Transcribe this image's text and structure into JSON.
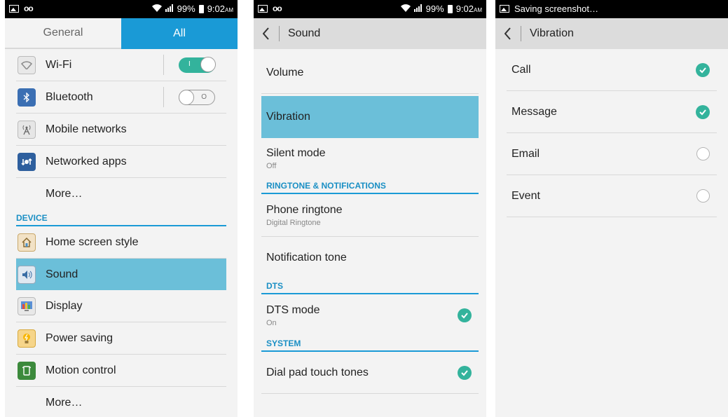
{
  "colors": {
    "accent": "#1a9ad6",
    "selected": "#6bbfd9",
    "check": "#33b39c"
  },
  "screen1": {
    "status": {
      "battery": "99%",
      "time": "9:02",
      "ampm": "AM"
    },
    "tabs": {
      "general": "General",
      "all": "All"
    },
    "items_top": [
      {
        "label": "Wi-Fi",
        "icon": "wifi-icon",
        "toggle": "on"
      },
      {
        "label": "Bluetooth",
        "icon": "bluetooth-icon",
        "toggle": "off"
      },
      {
        "label": "Mobile networks",
        "icon": "antenna-icon"
      },
      {
        "label": "Networked apps",
        "icon": "networked-apps-icon"
      },
      {
        "label": "More…"
      }
    ],
    "device_header": "DEVICE",
    "items_device": [
      {
        "label": "Home screen style",
        "icon": "home-icon"
      },
      {
        "label": "Sound",
        "icon": "speaker-icon",
        "selected": true
      },
      {
        "label": "Display",
        "icon": "display-icon"
      },
      {
        "label": "Power saving",
        "icon": "lightbulb-icon"
      },
      {
        "label": "Motion control",
        "icon": "motion-icon"
      },
      {
        "label": "More…"
      }
    ],
    "toggle_on_mark": "I",
    "toggle_off_mark": "O"
  },
  "screen2": {
    "status": {
      "battery": "99%",
      "time": "9:02",
      "ampm": "AM"
    },
    "title": "Sound",
    "volume": "Volume",
    "vibration": "Vibration",
    "silent_mode": {
      "label": "Silent mode",
      "sub": "Off"
    },
    "ringtone_header": "RINGTONE & NOTIFICATIONS",
    "phone_ringtone": {
      "label": "Phone ringtone",
      "sub": "Digital Ringtone"
    },
    "notification_tone": "Notification tone",
    "dts_header": "DTS",
    "dts_mode": {
      "label": "DTS mode",
      "sub": "On",
      "checked": true
    },
    "system_header": "SYSTEM",
    "dial_pad": {
      "label": "Dial pad touch tones",
      "checked": true
    }
  },
  "screen3": {
    "status": {
      "text": "Saving screenshot…"
    },
    "title": "Vibration",
    "items": [
      {
        "label": "Call",
        "checked": true
      },
      {
        "label": "Message",
        "checked": true
      },
      {
        "label": "Email",
        "checked": false
      },
      {
        "label": "Event",
        "checked": false
      }
    ]
  }
}
